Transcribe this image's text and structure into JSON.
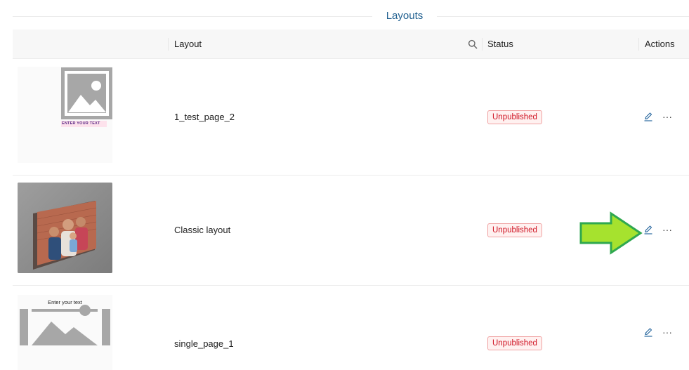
{
  "section": {
    "title": "Layouts"
  },
  "table": {
    "columns": {
      "layout": "Layout",
      "status": "Status",
      "actions": "Actions"
    },
    "rows": [
      {
        "name": "1_test_page_2",
        "status": "Unpublished",
        "thumbnail": "image-placeholder-with-text",
        "thumb_caption": "ENTER YOUR TEXT"
      },
      {
        "name": "Classic layout",
        "status": "Unpublished",
        "thumbnail": "family-canvas-photo"
      },
      {
        "name": "single_page_1",
        "status": "Unpublished",
        "thumbnail": "image-placeholder-banner",
        "thumb_caption": "Enter your text"
      }
    ]
  },
  "icons": {
    "search": "search-icon",
    "edit": "pencil-icon",
    "more": "ellipsis-icon",
    "callout": "green-arrow-callout"
  },
  "colors": {
    "title": "#1f5f8f",
    "badge_text": "#cf1322",
    "badge_border": "#f0a3a3",
    "badge_bg": "#fff1f0",
    "edit_icon": "#2c6aa0",
    "arrow_fill": "#a6e22e",
    "arrow_stroke": "#2fa84f"
  }
}
